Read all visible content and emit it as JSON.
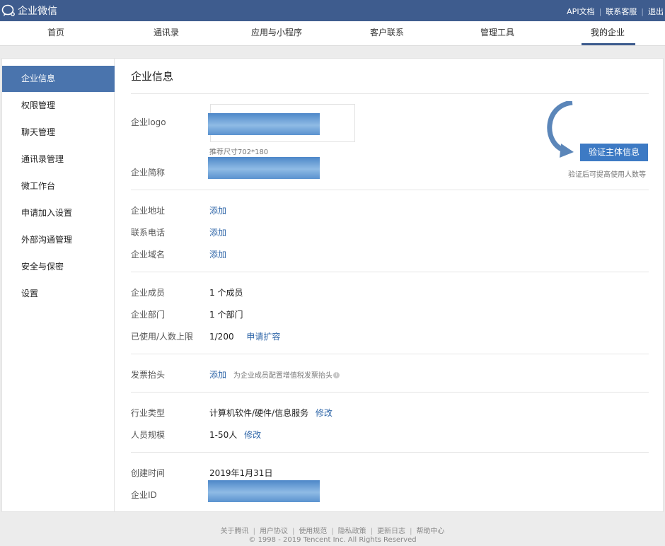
{
  "app": {
    "title": "企业微信"
  },
  "top_links": [
    "API文档",
    "联系客服",
    "退出"
  ],
  "nav": {
    "items": [
      "首页",
      "通讯录",
      "应用与小程序",
      "客户联系",
      "管理工具",
      "我的企业"
    ],
    "active": "我的企业"
  },
  "sidebar": {
    "items": [
      "企业信息",
      "权限管理",
      "聊天管理",
      "通讯录管理",
      "微工作台",
      "申请加入设置",
      "外部沟通管理",
      "安全与保密",
      "设置"
    ],
    "active": "企业信息"
  },
  "main": {
    "title": "企业信息",
    "logo": {
      "label": "企业logo",
      "hint": "推荐尺寸702*180"
    },
    "short_name": {
      "label": "企业简称"
    },
    "verify": {
      "button": "验证主体信息",
      "hint": "验证后可提高使用人数等"
    },
    "address": {
      "label": "企业地址",
      "action": "添加"
    },
    "phone": {
      "label": "联系电话",
      "action": "添加"
    },
    "domain": {
      "label": "企业域名",
      "action": "添加"
    },
    "members": {
      "label": "企业成员",
      "value": "1 个成员"
    },
    "departments": {
      "label": "企业部门",
      "value": "1 个部门"
    },
    "usage": {
      "label": "已使用/人数上限",
      "value": "1/200",
      "action": "申请扩容"
    },
    "invoice": {
      "label": "发票抬头",
      "action": "添加",
      "hint": "为企业成员配置增值税发票抬头"
    },
    "industry": {
      "label": "行业类型",
      "value": "计算机软件/硬件/信息服务",
      "action": "修改"
    },
    "scale": {
      "label": "人员规模",
      "value": "1-50人",
      "action": "修改"
    },
    "created": {
      "label": "创建时间",
      "value": "2019年1月31日"
    },
    "corp_id": {
      "label": "企业ID"
    }
  },
  "footer": {
    "links": [
      "关于腾讯",
      "用户协议",
      "使用规范",
      "隐私政策",
      "更新日志",
      "帮助中心"
    ],
    "copyright": "© 1998 - 2019 Tencent Inc. All Rights Reserved"
  },
  "colors": {
    "topbar": "#3e5c8e",
    "active_side": "#4a74ad",
    "link": "#2f66a8",
    "button": "#3d7ac4"
  }
}
